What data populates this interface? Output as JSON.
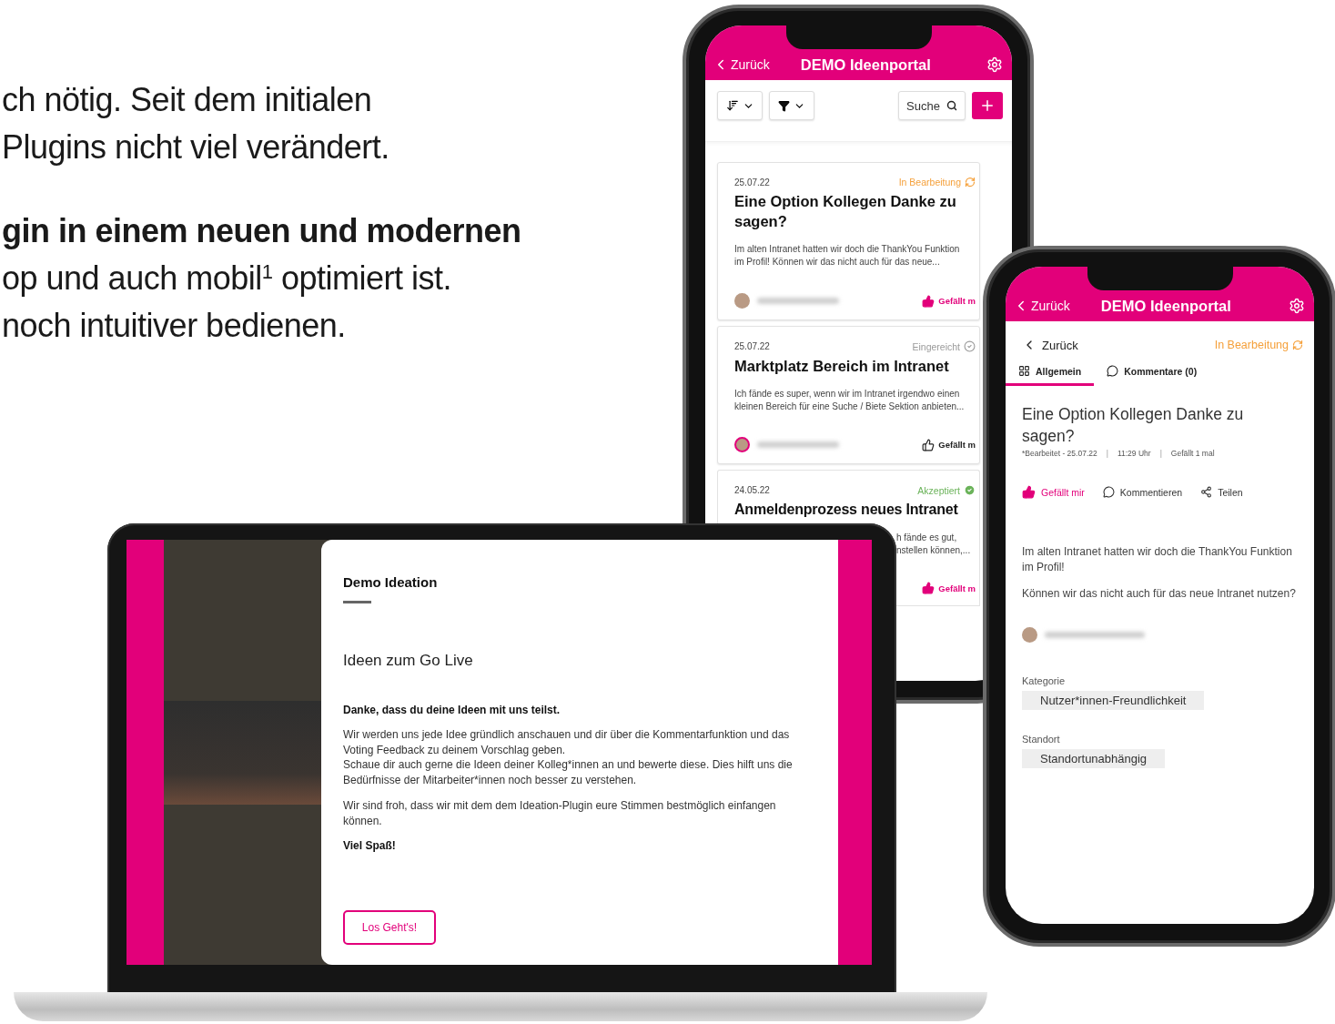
{
  "intro": {
    "paragraphs": [
      {
        "lines": [
          {
            "text": "ch nötig. Seit dem initialen",
            "bold": false
          },
          {
            "text": "Plugins nicht viel verändert.",
            "bold": false
          }
        ]
      },
      {
        "lines": [
          {
            "text": "gin in einem neuen und modernen",
            "bold": true
          },
          {
            "text": "op und auch mobil$^{1}$ optimiert ist.",
            "bold": false
          },
          {
            "text": "noch intuitiver bedienen.",
            "bold": false
          }
        ]
      }
    ]
  },
  "phone_list": {
    "header": {
      "back": "Zurück",
      "title": "DEMO Ideenportal"
    },
    "search": {
      "placeholder": "Suche"
    },
    "cards": [
      {
        "date": "25.07.22",
        "status": {
          "label": "In Bearbeitung",
          "kind": "progress"
        },
        "title": "Eine Option Kollegen Danke zu sagen?",
        "covered": false,
        "excerpt": [
          "Im alten Intranet hatten wir doch die ThankYou Funktion",
          "im Profil! Können wir das nicht auch für das neue..."
        ],
        "liked": true,
        "like_label": "Gefällt m"
      },
      {
        "date": "25.07.22",
        "status": {
          "label": "Eingereicht",
          "kind": "submitted"
        },
        "title": "Marktplatz Bereich im Intranet",
        "covered": false,
        "excerpt": [
          "Ich fände es super, wenn wir im Intranet irgendwo einen",
          "kleinen Bereich für eine Suche / Biete Sektion anbieten..."
        ],
        "liked": false,
        "like_label": "Gefällt m"
      },
      {
        "date": "24.05.22",
        "status": {
          "label": "Akzeptiert",
          "kind": "accepted"
        },
        "title": "Anmeldenprozess neues Intranet",
        "covered": true,
        "excerpt": [
          "h fände es gut,",
          "nstellen können,..."
        ],
        "liked": true,
        "like_label": "Gefällt m"
      }
    ]
  },
  "laptop": {
    "heading": "Demo Ideation",
    "subheading": "Ideen zum Go Live",
    "lead": "Danke, dass du deine Ideen mit uns teilst.",
    "paragraphs": [
      "Wir werden uns jede Idee gründlich anschauen und dir über die Kommentarfunktion und das Voting Feedback zu deinem Vorschlag geben.",
      "Schaue dir auch gerne die Ideen deiner Kolleg*innen an und bewerte diese. Dies hilft uns die Bedürfnisse der Mitarbeiter*innen noch besser zu verstehen.",
      "Wir sind froh, dass wir mit dem dem Ideation-Plugin eure Stimmen bestmöglich einfangen können."
    ],
    "closing": "Viel Spaß!",
    "button": "Los Geht's!"
  },
  "phone_detail": {
    "header": {
      "back": "Zurück",
      "title": "DEMO Ideenportal"
    },
    "back": "Zurück",
    "status": {
      "label": "In Bearbeitung",
      "kind": "progress"
    },
    "tabs": [
      {
        "label": "Allgemein",
        "kind": "grid",
        "selected": true
      },
      {
        "label": "Kommentare (0)",
        "kind": "comment",
        "selected": false
      }
    ],
    "title": "Eine Option Kollegen Danke zu sagen?",
    "meta": [
      "*Bearbeitet - 25.07.22",
      "|",
      "11:29 Uhr",
      "|",
      "Gefällt 1 mal"
    ],
    "actions": [
      {
        "label": "Gefällt mir",
        "kind": "like",
        "liked": true
      },
      {
        "label": "Kommentieren",
        "kind": "comment"
      },
      {
        "label": "Teilen",
        "kind": "share"
      }
    ],
    "body": [
      "Im alten Intranet hatten wir doch die ThankYou Funktion im Profil!",
      "Können wir das nicht auch für das neue Intranet nutzen?"
    ],
    "fields": [
      {
        "label": "Kategorie",
        "value": "Nutzer*innen-Freundlichkeit"
      },
      {
        "label": "Standort",
        "value": "Standortunabhängig"
      }
    ]
  }
}
